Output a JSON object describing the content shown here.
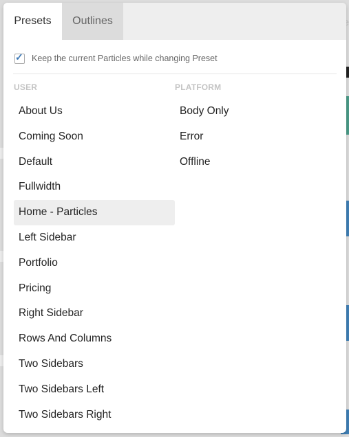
{
  "tabs": [
    {
      "label": "Presets",
      "active": true
    },
    {
      "label": "Outlines",
      "active": false
    }
  ],
  "keep_particles": {
    "checked": true,
    "label": "Keep the current Particles while changing Preset"
  },
  "user": {
    "heading": "USER",
    "items": [
      "About Us",
      "Coming Soon",
      "Default",
      "Fullwidth",
      "Home - Particles",
      "Left Sidebar",
      "Portfolio",
      "Pricing",
      "Right Sidebar",
      "Rows And Columns",
      "Two Sidebars",
      "Two Sidebars Left",
      "Two Sidebars Right"
    ],
    "selected": "Home - Particles"
  },
  "platform": {
    "heading": "PLATFORM",
    "items": [
      "Body Only",
      "Error",
      "Offline"
    ]
  },
  "background": {
    "edge_text": "e",
    "colors": {
      "teal": "#4a9b87",
      "blue": "#3f7fb5",
      "checkbox": "#3b78b6"
    }
  }
}
